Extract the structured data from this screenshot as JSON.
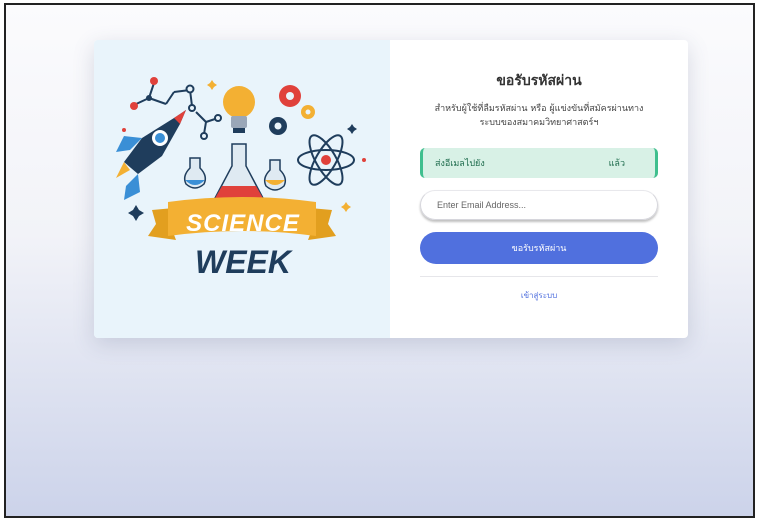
{
  "left_panel": {
    "logo_line1": "SCIENCE",
    "logo_line2": "WEEK"
  },
  "form": {
    "title": "ขอรับรหัสผ่าน",
    "subtitle_line1": "สำหรับผู้ใช้ที่ลืมรหัสผ่าน หรือ ผู้แข่งขันที่สมัครผ่านทาง",
    "subtitle_line2": "ระบบของสมาคมวิทยาศาสตร์ฯ",
    "alert_prefix": "ส่งอีเมลไปยัง",
    "alert_suffix": "แล้ว",
    "email_placeholder": "Enter Email Address...",
    "email_value": "",
    "submit_label": "ขอรับรหัสผ่าน",
    "login_link": "เข้าสู่ระบบ"
  },
  "colors": {
    "accent": "#5070de",
    "alert_bg": "#d8f1e6",
    "alert_border": "#3fbf8e",
    "left_bg": "#e9f4fb"
  }
}
